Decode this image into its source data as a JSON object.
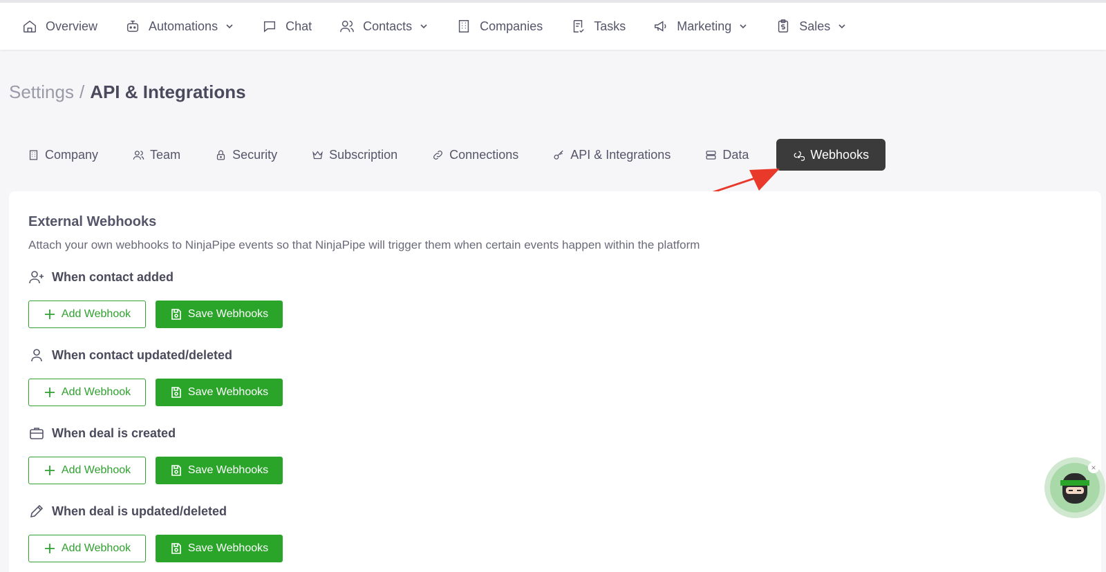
{
  "nav": {
    "items": [
      {
        "label": "Overview",
        "icon": "home-icon"
      },
      {
        "label": "Automations",
        "icon": "robot-icon",
        "dropdown": true
      },
      {
        "label": "Chat",
        "icon": "chat-icon"
      },
      {
        "label": "Contacts",
        "icon": "users-icon",
        "dropdown": true
      },
      {
        "label": "Companies",
        "icon": "building-icon"
      },
      {
        "label": "Tasks",
        "icon": "task-icon"
      },
      {
        "label": "Marketing",
        "icon": "megaphone-icon",
        "dropdown": true
      },
      {
        "label": "Sales",
        "icon": "clipboard-dollar-icon",
        "dropdown": true
      }
    ]
  },
  "breadcrumb": {
    "root": "Settings",
    "separator": "/",
    "current": "API & Integrations"
  },
  "tabs": [
    {
      "label": "Company",
      "icon": "building-icon"
    },
    {
      "label": "Team",
      "icon": "users-icon"
    },
    {
      "label": "Security",
      "icon": "lock-icon"
    },
    {
      "label": "Subscription",
      "icon": "crown-icon"
    },
    {
      "label": "Connections",
      "icon": "link-icon"
    },
    {
      "label": "API & Integrations",
      "icon": "key-icon"
    },
    {
      "label": "Data",
      "icon": "database-icon"
    },
    {
      "label": "Webhooks",
      "icon": "webhook-icon",
      "active": true
    }
  ],
  "card": {
    "title": "External Webhooks",
    "description": "Attach your own webhooks to NinjaPipe events so that NinjaPipe will trigger them when certain events happen within the platform"
  },
  "sections": [
    {
      "title": "When contact added",
      "icon": "user-plus-icon",
      "add_label": "Add Webhook",
      "save_label": "Save Webhooks"
    },
    {
      "title": "When contact updated/deleted",
      "icon": "user-icon",
      "add_label": "Add Webhook",
      "save_label": "Save Webhooks"
    },
    {
      "title": "When deal is created",
      "icon": "briefcase-icon",
      "add_label": "Add Webhook",
      "save_label": "Save Webhooks"
    },
    {
      "title": "When deal is updated/deleted",
      "icon": "pencil-icon",
      "add_label": "Add Webhook",
      "save_label": "Save Webhooks"
    }
  ],
  "colors": {
    "accent_green": "#2aa52a",
    "active_tab_bg": "#3b3b3b",
    "annotation_arrow": "#e8392b"
  }
}
